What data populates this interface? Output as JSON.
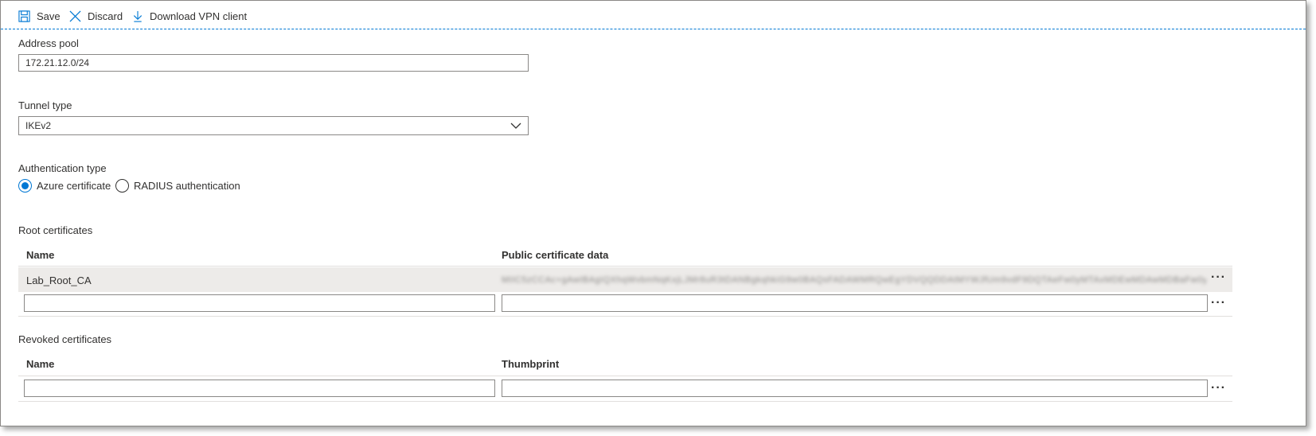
{
  "toolbar": {
    "save_label": "Save",
    "discard_label": "Discard",
    "download_label": "Download VPN client"
  },
  "address_pool": {
    "label": "Address pool",
    "value": "172.21.12.0/24"
  },
  "tunnel_type": {
    "label": "Tunnel type",
    "selected": "IKEv2"
  },
  "auth_type": {
    "label": "Authentication type",
    "options": [
      {
        "label": "Azure certificate",
        "selected": true
      },
      {
        "label": "RADIUS authentication",
        "selected": false
      }
    ]
  },
  "root_certs": {
    "label": "Root certificates",
    "columns": [
      "Name",
      "Public certificate data"
    ],
    "rows": [
      {
        "name": "Lab_Root_CA",
        "data": "MIIC5zCCAc+gAwIBAgIQXhqWvbmNqKxjLJMr8uR3tDANBgkqhkiG9w0BAQsFADAWMRQwEgYDVQQDDAtMYWJfUm9vdF9DQTAeFw0yMTAxMDEwMDAwMDBaFw0yNjAx"
      }
    ],
    "new_name_placeholder": "",
    "new_data_placeholder": ""
  },
  "revoked_certs": {
    "label": "Revoked certificates",
    "columns": [
      "Name",
      "Thumbprint"
    ],
    "new_name_placeholder": "",
    "new_thumb_placeholder": ""
  },
  "colors": {
    "accent": "#0078d4",
    "text": "#323130",
    "border": "#8a8886",
    "selected_row": "#edebe9"
  }
}
